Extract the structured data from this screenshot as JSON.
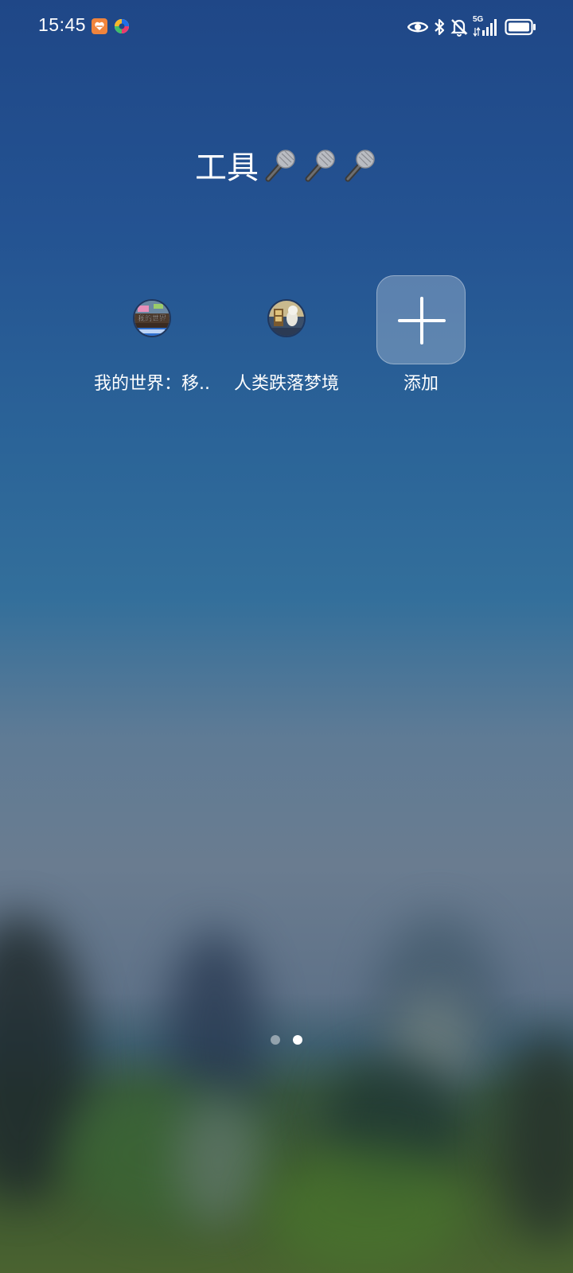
{
  "status_bar": {
    "time": "15:45",
    "notification_icons": [
      "app-notification-icon",
      "ai-assistant-icon"
    ],
    "system_icons": [
      "eye-icon",
      "bluetooth-icon",
      "mute-bell-icon",
      "5g-signal-icon",
      "battery-icon"
    ],
    "network_label": "5G"
  },
  "folder": {
    "title": "工具",
    "title_emoji": [
      "microphone-icon",
      "microphone-icon",
      "microphone-icon"
    ]
  },
  "apps": [
    {
      "label": "我的世界：移..",
      "icon": "minecraft-app-icon"
    },
    {
      "label": "人类跌落梦境",
      "icon": "human-fall-flat-app-icon"
    },
    {
      "label": "添加",
      "icon": "plus-icon"
    }
  ],
  "icon_texts": {
    "minecraft": "我的世界"
  },
  "page_indicator": {
    "pages": 2,
    "current_page": 2
  },
  "colors": {
    "wallpaper_top": "#1f4787",
    "wallpaper_bottom": "#4a6330",
    "text": "#ffffff",
    "add_tile": "rgba(255,255,255,0.25)"
  }
}
